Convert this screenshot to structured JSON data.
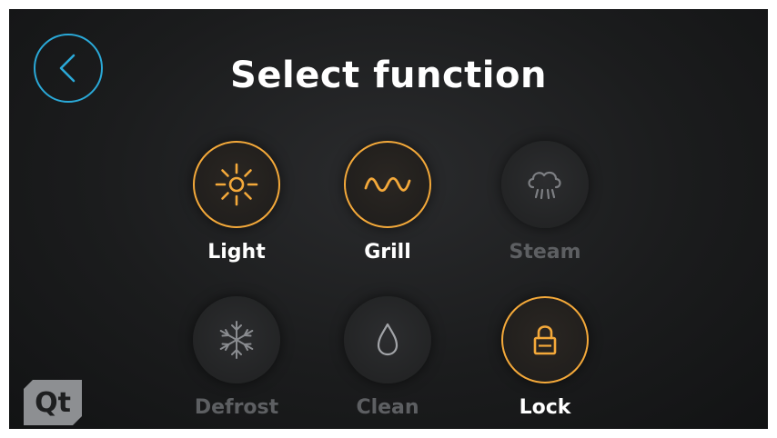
{
  "header": {
    "title": "Select function",
    "back_icon": "chevron-left-icon"
  },
  "colors": {
    "accent": "#f4a93a",
    "back_ring": "#2aa9d8",
    "inactive_text": "#5d5f62",
    "background": "#1b1c1d"
  },
  "functions": [
    {
      "label": "Light",
      "icon": "sun-icon",
      "active": true
    },
    {
      "label": "Grill",
      "icon": "grill-wave-icon",
      "active": true
    },
    {
      "label": "Steam",
      "icon": "steam-cloud-icon",
      "active": false
    },
    {
      "label": "Defrost",
      "icon": "snowflake-icon",
      "active": false
    },
    {
      "label": "Clean",
      "icon": "water-drop-icon",
      "active": false
    },
    {
      "label": "Lock",
      "icon": "lock-icon",
      "active": true
    }
  ],
  "branding": {
    "logo_text": "Qt"
  }
}
